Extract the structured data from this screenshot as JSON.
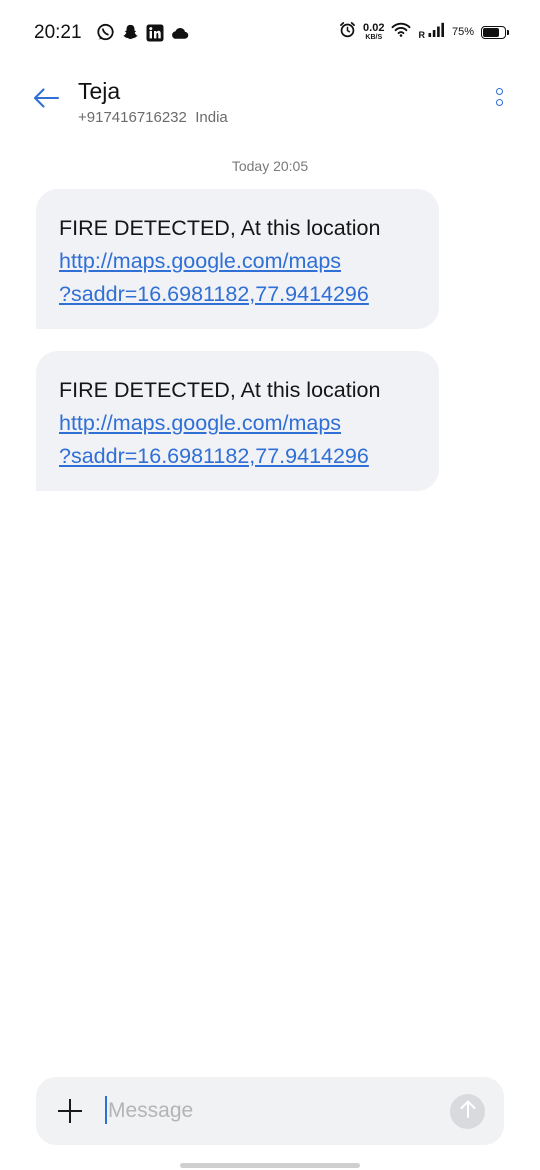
{
  "status_bar": {
    "time": "20:21",
    "left_icons": [
      "whatsapp-icon",
      "snapchat-icon",
      "linkedin-icon",
      "cloud-icon"
    ],
    "network_speed": "0.02",
    "network_speed_unit": "KB/S",
    "signal_prefix": "R",
    "battery_percent": "75%",
    "battery_level": 0.75
  },
  "header": {
    "contact_name": "Teja",
    "contact_number": "+917416716232",
    "contact_region": "India"
  },
  "conversation": {
    "day_stamp": "Today 20:05",
    "messages": [
      {
        "text": "FIRE DETECTED, At this location",
        "link_line1": "http://maps.google.com/maps",
        "link_line2": "?saddr=16.6981182,77.9414296"
      },
      {
        "text": "FIRE DETECTED, At this location",
        "link_line1": "http://maps.google.com/maps",
        "link_line2": "?saddr=16.6981182,77.9414296"
      }
    ]
  },
  "compose": {
    "placeholder": "Message"
  },
  "colors": {
    "accent": "#2f6fd6",
    "bubble_bg": "#f1f2f6"
  }
}
